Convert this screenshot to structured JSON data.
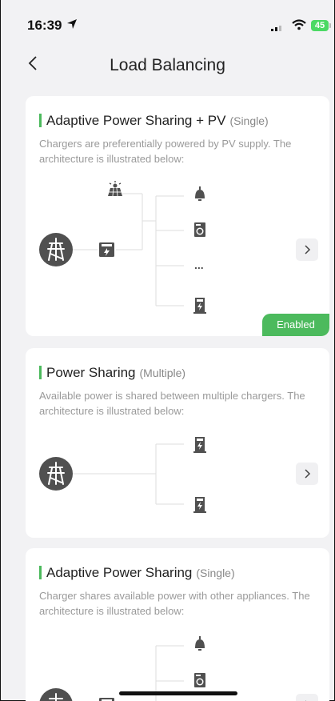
{
  "status_bar": {
    "time": "16:39",
    "battery": "45"
  },
  "nav": {
    "title": "Load Balancing"
  },
  "cards": [
    {
      "title": "Adaptive Power Sharing + PV",
      "mode": "(Single)",
      "description": "Chargers are preferentially powered by PV supply. The architecture is illustrated below:",
      "ellipsis": "...",
      "badge": "Enabled"
    },
    {
      "title": "Power Sharing",
      "mode": "(Multiple)",
      "description": "Available power is shared between multiple chargers. The architecture is illustrated below:"
    },
    {
      "title": "Adaptive Power Sharing",
      "mode": "(Single)",
      "description": "Charger shares available power with other appliances. The architecture is illustrated below:"
    }
  ],
  "colors": {
    "accent": "#4cba5d",
    "background": "#f2f2f4",
    "icon": "#505050"
  }
}
